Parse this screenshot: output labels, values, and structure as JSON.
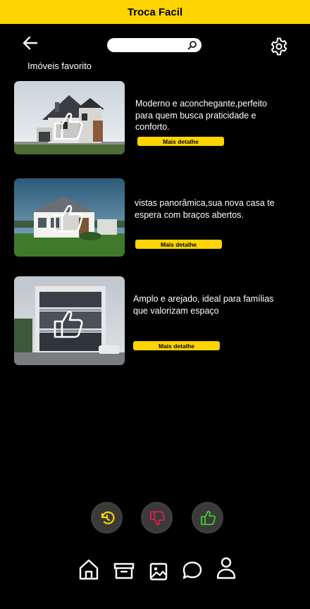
{
  "app": {
    "title": "Troca Facil"
  },
  "header": {
    "back_icon": "arrow-left-icon",
    "search_placeholder": "",
    "search_icon": "search-icon",
    "settings_icon": "gear-icon"
  },
  "section": {
    "title": "Imóveis favorito"
  },
  "listings": [
    {
      "description": "Moderno e aconchegante,perfeito para quem busca praticidade e conforto.",
      "button": "Mais detalhe",
      "icon": "thumbs-up-icon"
    },
    {
      "description": "vistas panorâmica,sua nova casa te espera com braços abertos.",
      "button": "Mais detalhe",
      "icon": "thumbs-up-icon"
    },
    {
      "description": "Amplo e arejado, ideal para famílias que valorizam espaço",
      "button": "Mais detalhe",
      "icon": "thumbs-up-icon"
    }
  ],
  "actions": [
    {
      "name": "undo",
      "icon": "undo-icon",
      "color": "#FFD400"
    },
    {
      "name": "dislike",
      "icon": "thumbs-down-icon",
      "color": "#E0204A"
    },
    {
      "name": "like",
      "icon": "thumbs-up-icon",
      "color": "#39D02A"
    }
  ],
  "bottom_nav": [
    {
      "name": "home",
      "icon": "home-icon"
    },
    {
      "name": "archive",
      "icon": "archive-icon"
    },
    {
      "name": "gallery",
      "icon": "image-icon"
    },
    {
      "name": "chat",
      "icon": "chat-bubble-icon"
    },
    {
      "name": "profile",
      "icon": "user-icon"
    }
  ],
  "colors": {
    "accent": "#FFD400",
    "background": "#000000"
  }
}
